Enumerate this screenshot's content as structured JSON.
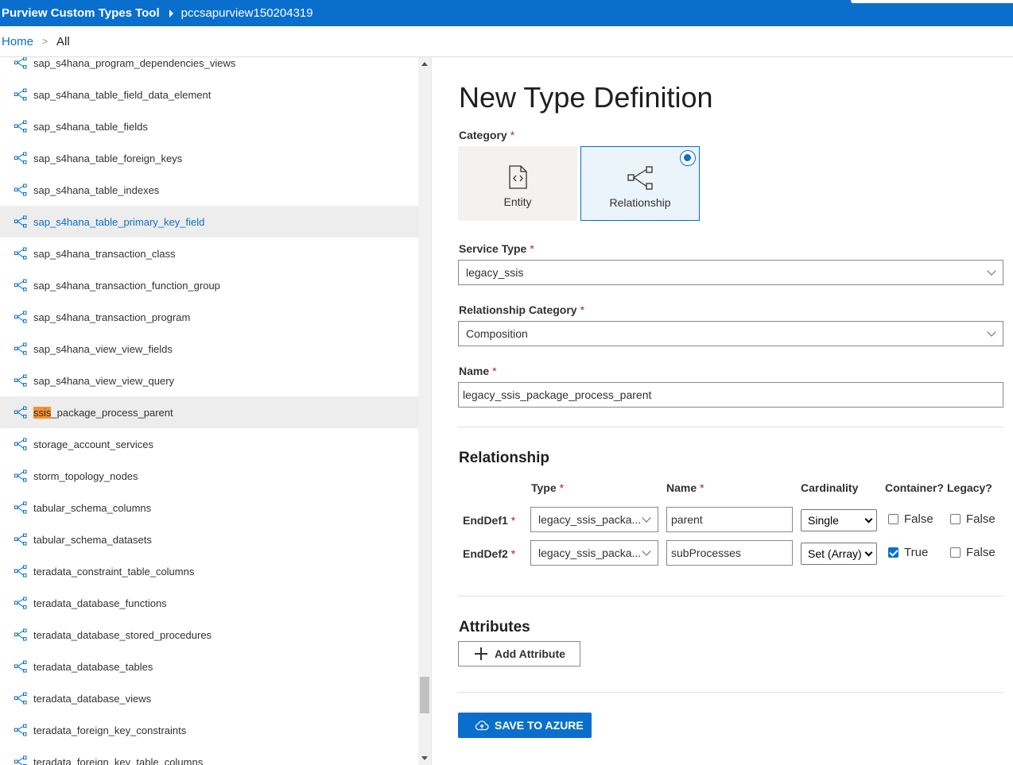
{
  "header": {
    "app_title": "Purview Custom Types Tool",
    "account": "pccsapurview150204319"
  },
  "breadcrumb": {
    "home": "Home",
    "separator": ">",
    "current": "All"
  },
  "tree": {
    "items": [
      {
        "label": "sap_s4hana_program_dependencies_views"
      },
      {
        "label": "sap_s4hana_table_field_data_element"
      },
      {
        "label": "sap_s4hana_table_fields"
      },
      {
        "label": "sap_s4hana_table_foreign_keys"
      },
      {
        "label": "sap_s4hana_table_indexes"
      },
      {
        "label": "sap_s4hana_table_primary_key_field"
      },
      {
        "label": "sap_s4hana_transaction_class"
      },
      {
        "label": "sap_s4hana_transaction_function_group"
      },
      {
        "label": "sap_s4hana_transaction_program"
      },
      {
        "label": "sap_s4hana_view_view_fields"
      },
      {
        "label": "sap_s4hana_view_view_query"
      },
      {
        "label_highlight": "ssis",
        "label_rest": "_package_process_parent"
      },
      {
        "label": "storage_account_services"
      },
      {
        "label": "storm_topology_nodes"
      },
      {
        "label": "tabular_schema_columns"
      },
      {
        "label": "tabular_schema_datasets"
      },
      {
        "label": "teradata_constraint_table_columns"
      },
      {
        "label": "teradata_database_functions"
      },
      {
        "label": "teradata_database_stored_procedures"
      },
      {
        "label": "teradata_database_tables"
      },
      {
        "label": "teradata_database_views"
      },
      {
        "label": "teradata_foreign_key_constraints"
      },
      {
        "label": "teradata_foreign_key_table_columns"
      }
    ],
    "selected_item": "sap_s4hana_table_primary_key_field",
    "item_icon": "relationship-icon"
  },
  "form": {
    "title": "New Type Definition",
    "required_marker": "*",
    "category": {
      "label": "Category",
      "options": [
        {
          "label": "Entity",
          "icon": "entity-file-icon"
        },
        {
          "label": "Relationship",
          "icon": "relationship-icon"
        }
      ],
      "selected": "Relationship"
    },
    "service_type": {
      "label": "Service Type",
      "value": "legacy_ssis"
    },
    "relationship_category": {
      "label": "Relationship Category",
      "value": "Composition"
    },
    "name": {
      "label": "Name",
      "value": "legacy_ssis_package_process_parent"
    },
    "relationship": {
      "title": "Relationship",
      "columns": {
        "type": "Type",
        "name": "Name",
        "cardinality": "Cardinality",
        "container": "Container?",
        "legacy": "Legacy?"
      },
      "rows": [
        {
          "label": "EndDef1",
          "type": "legacy_ssis_packa...",
          "name": "parent",
          "cardinality": "Single",
          "container": false,
          "container_label": "False",
          "legacy": false,
          "legacy_label": "False"
        },
        {
          "label": "EndDef2",
          "type": "legacy_ssis_packa...",
          "name": "subProcesses",
          "cardinality": "Set (Array)",
          "container": true,
          "container_label": "True",
          "legacy": false,
          "legacy_label": "False"
        }
      ]
    },
    "attributes": {
      "title": "Attributes",
      "add_button": "Add Attribute"
    },
    "save_button": "SAVE TO AZURE"
  },
  "colors": {
    "accent": "#0a6fcc",
    "highlight": "#f7902a",
    "required": "#a4262c"
  }
}
